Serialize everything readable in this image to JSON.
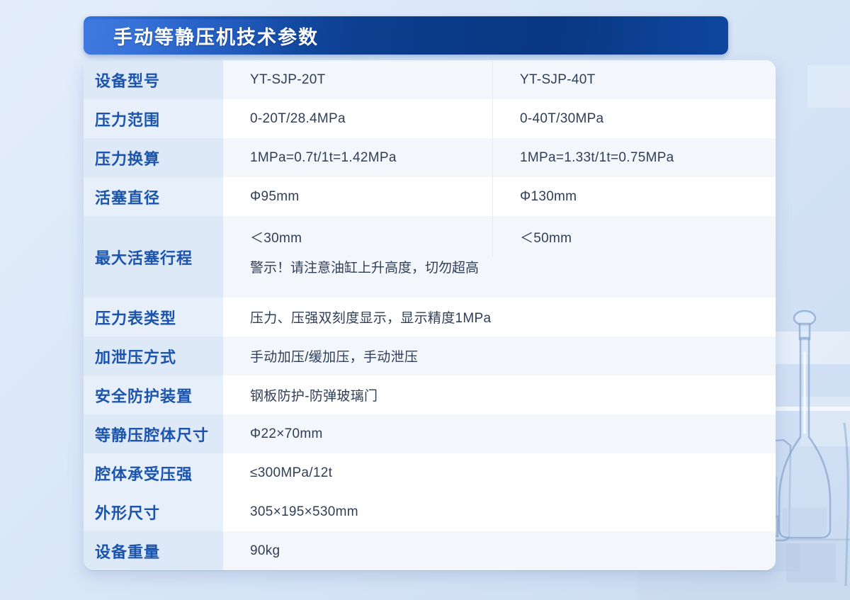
{
  "page": {
    "title": "手动等静压机技术参数"
  },
  "colors": {
    "header_gradient_start": "#3273de",
    "header_gradient_end": "#0e47a0",
    "label_text": "#1b54ad",
    "value_text": "#2f3e57",
    "label_bg_pale": "#dee9f7",
    "label_bg_alt": "#e7effa",
    "value_bg_pale": "#f3f7fc",
    "value_bg_white": "#ffffff"
  },
  "table": {
    "rows": [
      {
        "label": "设备型号",
        "type": "two",
        "col1": "YT-SJP-20T",
        "col2": "YT-SJP-40T",
        "shade": "pale"
      },
      {
        "label": "压力范围",
        "type": "two",
        "col1": "0-20T/28.4MPa",
        "col2": "0-40T/30MPa",
        "shade": "white"
      },
      {
        "label": "压力换算",
        "type": "two",
        "col1": "1MPa=0.7t/1t=1.42MPa",
        "col2": "1MPa=1.33t/1t=0.75MPa",
        "shade": "pale"
      },
      {
        "label": "活塞直径",
        "type": "two",
        "col1": "Φ95mm",
        "col2": "Φ130mm",
        "shade": "white"
      },
      {
        "label": "最大活塞行程",
        "type": "two-warning",
        "col1": "＜30mm",
        "col2": "＜50mm",
        "warning": "警示！请注意油缸上升高度，切勿超高",
        "shade": "pale"
      },
      {
        "label": "压力表类型",
        "type": "span",
        "value": "压力、压强双刻度显示，显示精度1MPa",
        "shade": "white"
      },
      {
        "label": "加泄压方式",
        "type": "span",
        "value": "手动加压/缓加压，手动泄压",
        "shade": "pale"
      },
      {
        "label": "安全防护装置",
        "type": "span",
        "value": "钢板防护-防弹玻璃门",
        "shade": "white"
      },
      {
        "label": "等静压腔体尺寸",
        "type": "span",
        "value": "Φ22×70mm",
        "shade": "pale"
      },
      {
        "label": "腔体承受压强",
        "type": "span",
        "value": "≤300MPa/12t",
        "shade": "white"
      },
      {
        "label": "外形尺寸",
        "type": "span",
        "value": "305×195×530mm",
        "shade": "white"
      },
      {
        "label": "设备重量",
        "type": "span",
        "value": "90kg",
        "shade": "pale"
      }
    ]
  },
  "decoration": {
    "glassware": [
      "volumetric-flask",
      "beaker",
      "reagent-bottle"
    ]
  }
}
